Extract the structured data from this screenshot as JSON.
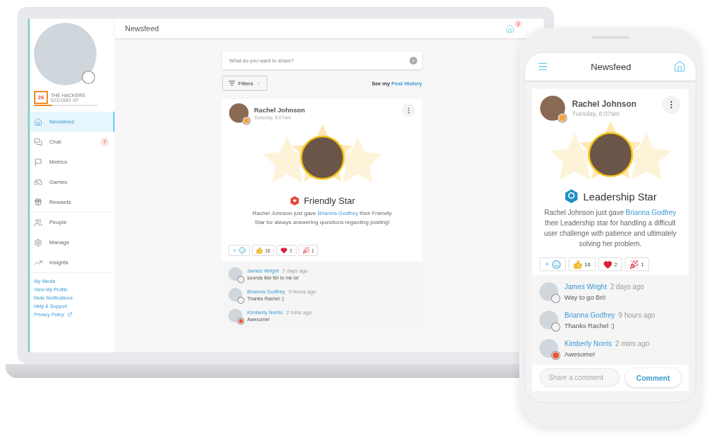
{
  "laptop": {
    "sidebar": {
      "profile": {
        "rank": "26",
        "team": "THE HACKERS",
        "xp": "523/1889 XP",
        "level": 0.28
      },
      "nav": [
        {
          "label": "Newsfeed",
          "selected": true
        },
        {
          "label": "Chat",
          "selected": false,
          "badge": "7"
        },
        {
          "label": "Metrics",
          "selected": false
        },
        {
          "label": "Games",
          "selected": false
        },
        {
          "label": "Rewards",
          "selected": false
        },
        {
          "label": "People",
          "selected": false
        },
        {
          "label": "Manage",
          "selected": false
        },
        {
          "label": "Insights",
          "selected": false
        }
      ],
      "links": [
        {
          "label": "My Media",
          "external": false
        },
        {
          "label": "View My Profile",
          "external": false
        },
        {
          "label": "Mute Notifications",
          "external": false
        },
        {
          "label": "Help & Support",
          "external": false
        },
        {
          "label": "Privacy Policy",
          "external": true
        }
      ]
    },
    "topbar": {
      "title": "Newsfeed",
      "notification_count": "3"
    },
    "composer": {
      "placeholder": "What do you want to share?"
    },
    "filters": {
      "label": "Filters"
    },
    "post_history": {
      "prefix": "See my",
      "link": "Post History"
    },
    "post": {
      "author": "Rachel Johnson",
      "time": "Tuesday, 8:07am",
      "award": {
        "kind": "friendly",
        "title": "Friendly Star"
      },
      "message": {
        "before": "Rachel Johnson just gave",
        "link": "Brianna Godfrey",
        "after": "their Friendly Star for always answering questions regarding posting!"
      },
      "reactions": [
        {
          "kind": "add"
        },
        {
          "kind": "like",
          "count": "16"
        },
        {
          "kind": "heart",
          "count": "2"
        },
        {
          "kind": "party",
          "count": "1"
        }
      ],
      "comments": [
        {
          "name": "James Wright",
          "time": "2 days ago",
          "text": "sounds like Bri to me lol"
        },
        {
          "name": "Brianna Godfrey",
          "time": "9 hours ago",
          "text": "Thanks Rachel :)"
        },
        {
          "name": "Kimberly Norris",
          "time": "2 mins ago",
          "text": "Awesome!"
        }
      ]
    }
  },
  "phone": {
    "header": {
      "title": "Newsfeed"
    },
    "post": {
      "author": "Rachel Johnson",
      "time": "Tuesday, 8:07am",
      "award": {
        "kind": "leadership",
        "title": "Leadership Star"
      },
      "message": {
        "before": "Rachel Johnson just gave",
        "link": "Brianna Godfrey",
        "after": "their Leadership star for handling a difficult user challenge with patience and ultimately solving her problem."
      },
      "reactions": [
        {
          "kind": "add"
        },
        {
          "kind": "like",
          "count": "16"
        },
        {
          "kind": "heart",
          "count": "2"
        },
        {
          "kind": "party",
          "count": "1"
        }
      ],
      "comments": [
        {
          "name": "James Wright",
          "time": "2 days ago",
          "text": "Way to go Bri!"
        },
        {
          "name": "Brianna Godfrey",
          "time": "9 hours ago",
          "text": "Thanks Rachel :)"
        },
        {
          "name": "Kimberly Norris",
          "time": "2 mins ago",
          "text": "Awesome!"
        }
      ]
    },
    "comment_box": {
      "placeholder": "Share a comment"
    },
    "comment_button": "Comment"
  }
}
